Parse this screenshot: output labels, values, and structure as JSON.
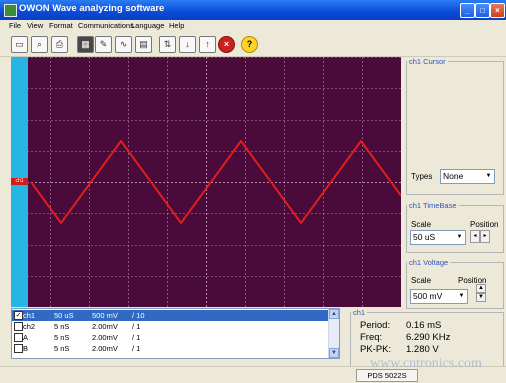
{
  "app": {
    "title": "OWON Wave analyzing software"
  },
  "window_buttons": {
    "minimize": "_",
    "maximize": "□",
    "close": "×"
  },
  "menu": [
    "File",
    "View",
    "Format",
    "Communications",
    "Language",
    "Help"
  ],
  "toolbar": {
    "icons": [
      "open-folder",
      "print-preview",
      "print",
      "table-view",
      "edit-view",
      "waveform-chart",
      "grid-chart",
      "connect-usb",
      "download",
      "upload",
      "stop",
      "help"
    ],
    "help_glyph": "?",
    "stop_glyph": "×"
  },
  "scope": {
    "background": "#4a0a3a",
    "grid_color": "#b48cb0",
    "trace_color": "#e11d1d",
    "strip_color": "#27b6e3",
    "channel_marker": "ch1"
  },
  "cursor_panel": {
    "title": "ch1 Cursor",
    "types_label": "Types",
    "types_value": "None"
  },
  "timebase_panel": {
    "title": "ch1 TimeBase",
    "scale_label": "Scale",
    "scale_value": "50 uS",
    "position_label": "Position"
  },
  "voltage_panel": {
    "title": "ch1 Voltage",
    "scale_label": "Scale",
    "scale_value": "500 mV",
    "position_label": "Position"
  },
  "channels": [
    {
      "name": "ch1",
      "time": "50 uS",
      "volt": "500 mV",
      "probe": "/ 10",
      "checked": true,
      "selected": true
    },
    {
      "name": "ch2",
      "time": "5 nS",
      "volt": "2.00mV",
      "probe": "/ 1",
      "checked": false,
      "selected": false
    },
    {
      "name": "A",
      "time": "5 nS",
      "volt": "2.00mV",
      "probe": "/ 1",
      "checked": false,
      "selected": false
    },
    {
      "name": "B",
      "time": "5 nS",
      "volt": "2.00mV",
      "probe": "/ 1",
      "checked": false,
      "selected": false
    }
  ],
  "measurements": {
    "title": "ch1",
    "rows": [
      {
        "label": "Period:",
        "value": "0.16 mS"
      },
      {
        "label": "Freq:",
        "value": "6.290 KHz"
      },
      {
        "label": "PK-PK:",
        "value": "1.280 V"
      }
    ]
  },
  "status": {
    "device": "PDS 5022S"
  },
  "watermark": "www.cntronics.com"
}
